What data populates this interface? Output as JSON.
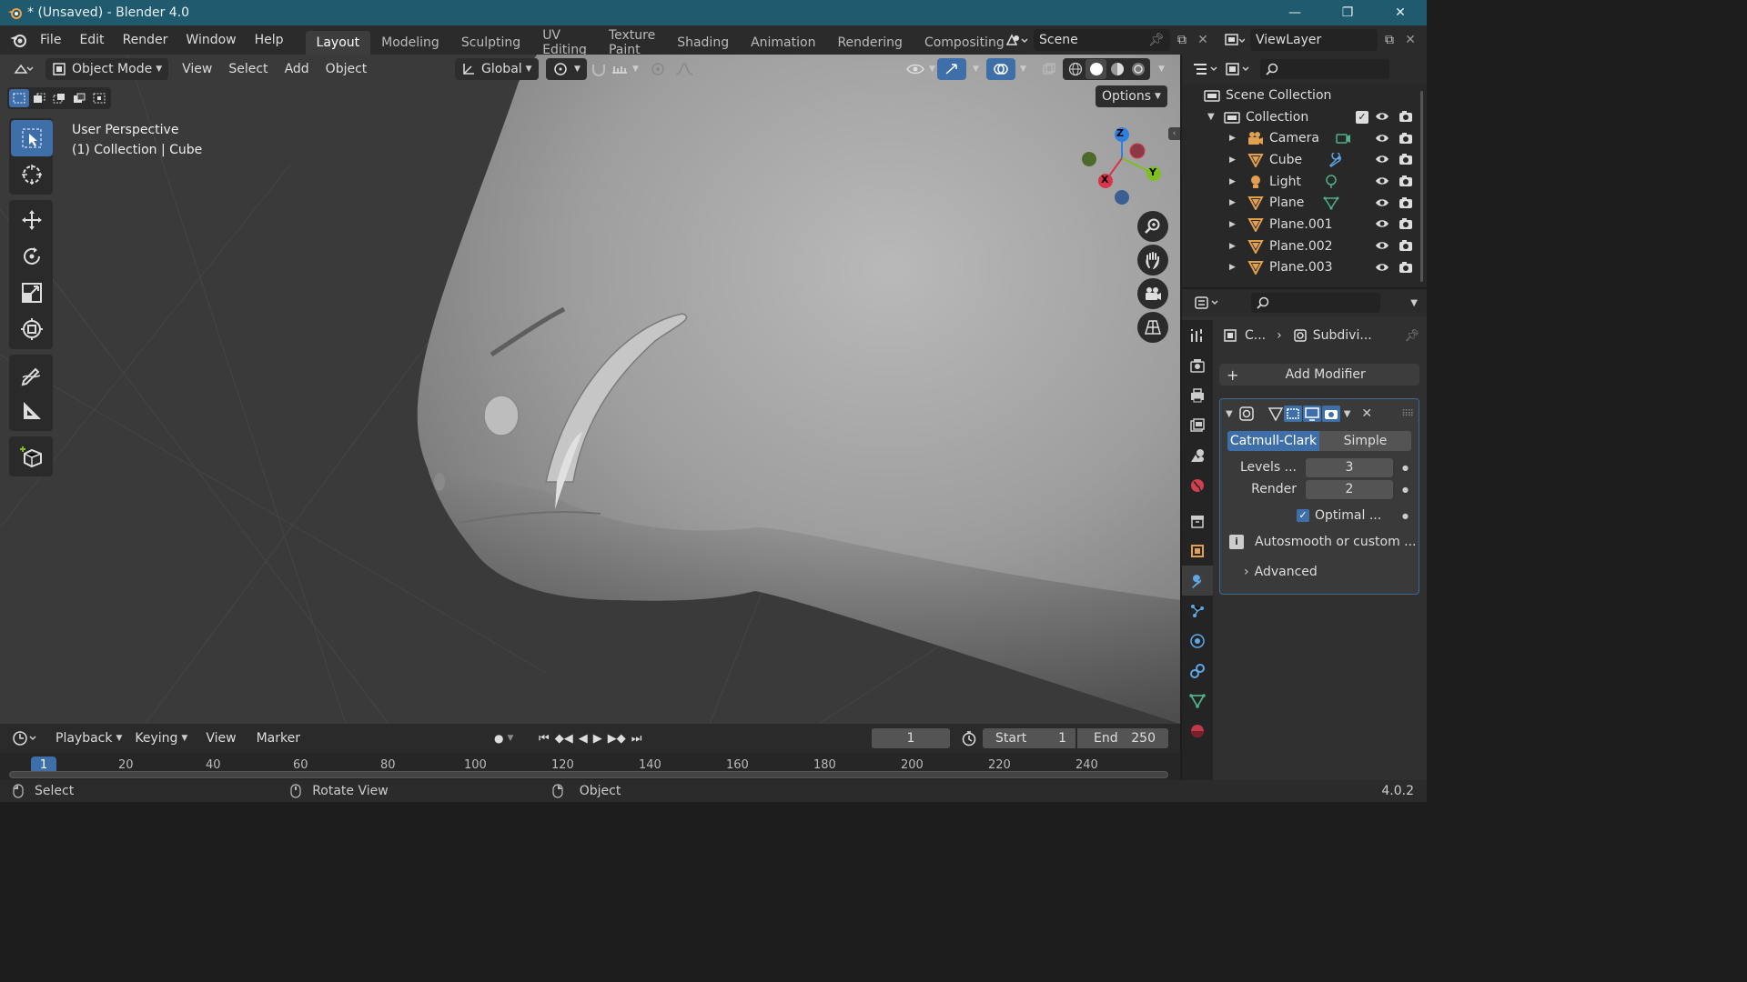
{
  "window": {
    "title": "* (Unsaved) - Blender 4.0",
    "controls": {
      "minimize": "minimize-icon",
      "maximize": "maximize-icon",
      "close": "close-icon"
    }
  },
  "menubar": {
    "items": [
      "File",
      "Edit",
      "Render",
      "Window",
      "Help"
    ],
    "workspaces": [
      "Layout",
      "Modeling",
      "Sculpting",
      "UV Editing",
      "Texture Paint",
      "Shading",
      "Animation",
      "Rendering",
      "Compositing"
    ],
    "active_workspace": "Layout",
    "scene": "Scene",
    "view_layer": "ViewLayer"
  },
  "viewport": {
    "mode": "Object Mode",
    "menus": [
      "View",
      "Select",
      "Add",
      "Object"
    ],
    "transform_orientation": "Global",
    "options_label": "Options",
    "overlay_text": {
      "line1": "User Perspective",
      "line2": "(1) Collection | Cube"
    },
    "gizmo": {
      "z": "Z",
      "y": "Y",
      "x": "X"
    },
    "colors": {
      "background": "#3a3a3a",
      "x_axis": "#d9344b",
      "y_axis": "#7fbf1f",
      "z_axis": "#2f7fe0"
    }
  },
  "outliner": {
    "root": "Scene Collection",
    "collection": "Collection",
    "items": [
      {
        "name": "Camera",
        "icon": "camera-icon",
        "extra": "camera-data-icon"
      },
      {
        "name": "Cube",
        "icon": "mesh-icon",
        "extra": "modifier-wrench-icon"
      },
      {
        "name": "Light",
        "icon": "light-icon",
        "extra": "light-data-icon"
      },
      {
        "name": "Plane",
        "icon": "mesh-icon",
        "extra": "mesh-data-icon"
      },
      {
        "name": "Plane.001",
        "icon": "mesh-icon",
        "extra": ""
      },
      {
        "name": "Plane.002",
        "icon": "mesh-icon",
        "extra": ""
      },
      {
        "name": "Plane.003",
        "icon": "mesh-icon",
        "extra": ""
      }
    ]
  },
  "properties": {
    "breadcrumb_object": "C...",
    "breadcrumb_modifier": "Subdivi...",
    "add_modifier": "Add Modifier",
    "subdiv": {
      "type_catmull": "Catmull-Clark",
      "type_simple": "Simple",
      "levels_label": "Levels ...",
      "levels_value": "3",
      "render_label": "Render",
      "render_value": "2",
      "optimal_label": "Optimal ...",
      "info_text": "Autosmooth or custom ...",
      "advanced_label": "Advanced"
    }
  },
  "timeline": {
    "menus": [
      "Playback",
      "Keying",
      "View",
      "Marker"
    ],
    "current_frame": "1",
    "start_label": "Start",
    "start_value": "1",
    "end_label": "End",
    "end_value": "250",
    "ruler_current": "1",
    "ruler_ticks": [
      "20",
      "40",
      "60",
      "80",
      "100",
      "120",
      "140",
      "160",
      "180",
      "200",
      "220",
      "240"
    ]
  },
  "statusbar": {
    "hint1": "Select",
    "hint2": "Rotate View",
    "hint3": "Object",
    "version": "4.0.2"
  }
}
